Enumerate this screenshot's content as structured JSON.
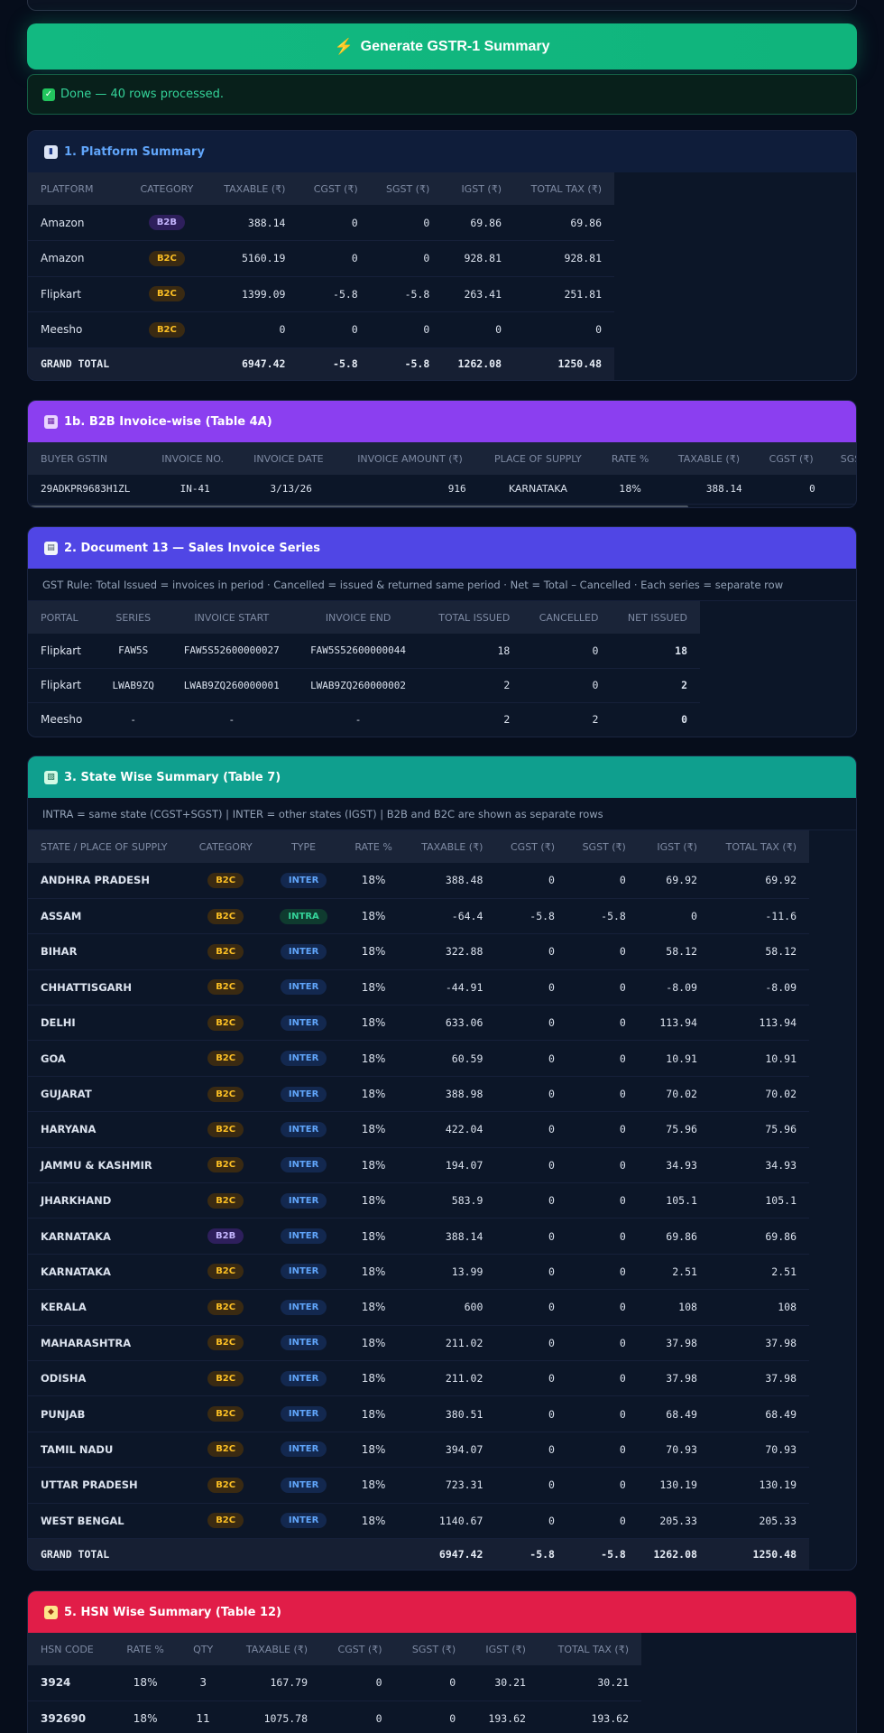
{
  "generate_button": {
    "label": "Generate GSTR-1 Summary"
  },
  "status": {
    "message": "Done — 40 rows processed."
  },
  "platform_summary": {
    "title": "1. Platform Summary",
    "columns": [
      "PLATFORM",
      "CATEGORY",
      "TAXABLE (₹)",
      "CGST (₹)",
      "SGST (₹)",
      "IGST (₹)",
      "TOTAL TAX (₹)"
    ],
    "rows": [
      {
        "platform": "Amazon",
        "category": "B2B",
        "taxable": "388.14",
        "cgst": "0",
        "sgst": "0",
        "igst": "69.86",
        "total": "69.86"
      },
      {
        "platform": "Amazon",
        "category": "B2C",
        "taxable": "5160.19",
        "cgst": "0",
        "sgst": "0",
        "igst": "928.81",
        "total": "928.81"
      },
      {
        "platform": "Flipkart",
        "category": "B2C",
        "taxable": "1399.09",
        "cgst": "-5.8",
        "sgst": "-5.8",
        "igst": "263.41",
        "total": "251.81"
      },
      {
        "platform": "Meesho",
        "category": "B2C",
        "taxable": "0",
        "cgst": "0",
        "sgst": "0",
        "igst": "0",
        "total": "0"
      }
    ],
    "total": {
      "label": "GRAND TOTAL",
      "taxable": "6947.42",
      "cgst": "-5.8",
      "sgst": "-5.8",
      "igst": "1262.08",
      "total": "1250.48"
    }
  },
  "b2b_invoice": {
    "title": "1b. B2B Invoice-wise (Table 4A)",
    "columns": [
      "BUYER GSTIN",
      "INVOICE NO.",
      "INVOICE DATE",
      "INVOICE AMOUNT (₹)",
      "PLACE OF SUPPLY",
      "RATE %",
      "TAXABLE (₹)",
      "CGST (₹)",
      "SGS"
    ],
    "rows": [
      {
        "gstin": "29ADKPR9683H1ZL",
        "invoice_no": "IN-41",
        "date": "3/13/26",
        "amount": "916",
        "place": "KARNATAKA",
        "rate": "18%",
        "taxable": "388.14",
        "cgst": "0",
        "sgst": ""
      }
    ]
  },
  "document_series": {
    "title": "2. Document 13 — Sales Invoice Series",
    "note": "GST Rule: Total Issued = invoices in period · Cancelled = issued & returned same period · Net = Total – Cancelled · Each series = separate row",
    "columns": [
      "PORTAL",
      "SERIES",
      "INVOICE START",
      "INVOICE END",
      "TOTAL ISSUED",
      "CANCELLED",
      "NET ISSUED"
    ],
    "rows": [
      {
        "portal": "Flipkart",
        "series": "FAW5S",
        "start": "FAW5S52600000027",
        "end": "FAW5S52600000044",
        "issued": "18",
        "cancelled": "0",
        "net": "18"
      },
      {
        "portal": "Flipkart",
        "series": "LWAB9ZQ",
        "start": "LWAB9ZQ260000001",
        "end": "LWAB9ZQ260000002",
        "issued": "2",
        "cancelled": "0",
        "net": "2"
      },
      {
        "portal": "Meesho",
        "series": "-",
        "start": "-",
        "end": "-",
        "issued": "2",
        "cancelled": "2",
        "net": "0"
      }
    ]
  },
  "state_summary": {
    "title": "3. State Wise Summary (Table 7)",
    "note": "INTRA = same state (CGST+SGST) | INTER = other states (IGST) | B2B and B2C are shown as separate rows",
    "columns": [
      "STATE / PLACE OF SUPPLY",
      "CATEGORY",
      "TYPE",
      "RATE %",
      "TAXABLE (₹)",
      "CGST (₹)",
      "SGST (₹)",
      "IGST (₹)",
      "TOTAL TAX (₹)"
    ],
    "rows": [
      {
        "state": "ANDHRA PRADESH",
        "category": "B2C",
        "type": "INTER",
        "rate": "18%",
        "taxable": "388.48",
        "cgst": "0",
        "sgst": "0",
        "igst": "69.92",
        "total": "69.92"
      },
      {
        "state": "ASSAM",
        "category": "B2C",
        "type": "INTRA",
        "rate": "18%",
        "taxable": "-64.4",
        "cgst": "-5.8",
        "sgst": "-5.8",
        "igst": "0",
        "total": "-11.6"
      },
      {
        "state": "BIHAR",
        "category": "B2C",
        "type": "INTER",
        "rate": "18%",
        "taxable": "322.88",
        "cgst": "0",
        "sgst": "0",
        "igst": "58.12",
        "total": "58.12"
      },
      {
        "state": "CHHATTISGARH",
        "category": "B2C",
        "type": "INTER",
        "rate": "18%",
        "taxable": "-44.91",
        "cgst": "0",
        "sgst": "0",
        "igst": "-8.09",
        "total": "-8.09"
      },
      {
        "state": "DELHI",
        "category": "B2C",
        "type": "INTER",
        "rate": "18%",
        "taxable": "633.06",
        "cgst": "0",
        "sgst": "0",
        "igst": "113.94",
        "total": "113.94"
      },
      {
        "state": "GOA",
        "category": "B2C",
        "type": "INTER",
        "rate": "18%",
        "taxable": "60.59",
        "cgst": "0",
        "sgst": "0",
        "igst": "10.91",
        "total": "10.91"
      },
      {
        "state": "GUJARAT",
        "category": "B2C",
        "type": "INTER",
        "rate": "18%",
        "taxable": "388.98",
        "cgst": "0",
        "sgst": "0",
        "igst": "70.02",
        "total": "70.02"
      },
      {
        "state": "HARYANA",
        "category": "B2C",
        "type": "INTER",
        "rate": "18%",
        "taxable": "422.04",
        "cgst": "0",
        "sgst": "0",
        "igst": "75.96",
        "total": "75.96"
      },
      {
        "state": "JAMMU & KASHMIR",
        "category": "B2C",
        "type": "INTER",
        "rate": "18%",
        "taxable": "194.07",
        "cgst": "0",
        "sgst": "0",
        "igst": "34.93",
        "total": "34.93"
      },
      {
        "state": "JHARKHAND",
        "category": "B2C",
        "type": "INTER",
        "rate": "18%",
        "taxable": "583.9",
        "cgst": "0",
        "sgst": "0",
        "igst": "105.1",
        "total": "105.1"
      },
      {
        "state": "KARNATAKA",
        "category": "B2B",
        "type": "INTER",
        "rate": "18%",
        "taxable": "388.14",
        "cgst": "0",
        "sgst": "0",
        "igst": "69.86",
        "total": "69.86"
      },
      {
        "state": "KARNATAKA",
        "category": "B2C",
        "type": "INTER",
        "rate": "18%",
        "taxable": "13.99",
        "cgst": "0",
        "sgst": "0",
        "igst": "2.51",
        "total": "2.51"
      },
      {
        "state": "KERALA",
        "category": "B2C",
        "type": "INTER",
        "rate": "18%",
        "taxable": "600",
        "cgst": "0",
        "sgst": "0",
        "igst": "108",
        "total": "108"
      },
      {
        "state": "MAHARASHTRA",
        "category": "B2C",
        "type": "INTER",
        "rate": "18%",
        "taxable": "211.02",
        "cgst": "0",
        "sgst": "0",
        "igst": "37.98",
        "total": "37.98"
      },
      {
        "state": "ODISHA",
        "category": "B2C",
        "type": "INTER",
        "rate": "18%",
        "taxable": "211.02",
        "cgst": "0",
        "sgst": "0",
        "igst": "37.98",
        "total": "37.98"
      },
      {
        "state": "PUNJAB",
        "category": "B2C",
        "type": "INTER",
        "rate": "18%",
        "taxable": "380.51",
        "cgst": "0",
        "sgst": "0",
        "igst": "68.49",
        "total": "68.49"
      },
      {
        "state": "TAMIL NADU",
        "category": "B2C",
        "type": "INTER",
        "rate": "18%",
        "taxable": "394.07",
        "cgst": "0",
        "sgst": "0",
        "igst": "70.93",
        "total": "70.93"
      },
      {
        "state": "UTTAR PRADESH",
        "category": "B2C",
        "type": "INTER",
        "rate": "18%",
        "taxable": "723.31",
        "cgst": "0",
        "sgst": "0",
        "igst": "130.19",
        "total": "130.19"
      },
      {
        "state": "WEST BENGAL",
        "category": "B2C",
        "type": "INTER",
        "rate": "18%",
        "taxable": "1140.67",
        "cgst": "0",
        "sgst": "0",
        "igst": "205.33",
        "total": "205.33"
      }
    ],
    "total": {
      "label": "GRAND TOTAL",
      "taxable": "6947.42",
      "cgst": "-5.8",
      "sgst": "-5.8",
      "igst": "1262.08",
      "total": "1250.48"
    }
  },
  "hsn_summary": {
    "title": "5. HSN Wise Summary (Table 12)",
    "columns": [
      "HSN CODE",
      "RATE %",
      "QTY",
      "TAXABLE (₹)",
      "CGST (₹)",
      "SGST (₹)",
      "IGST (₹)",
      "TOTAL TAX (₹)"
    ],
    "rows": [
      {
        "hsn": "3924",
        "rate": "18%",
        "qty": "3",
        "taxable": "167.79",
        "cgst": "0",
        "sgst": "0",
        "igst": "30.21",
        "total": "30.21"
      },
      {
        "hsn": "392690",
        "rate": "18%",
        "qty": "11",
        "taxable": "1075.78",
        "cgst": "0",
        "sgst": "0",
        "igst": "193.62",
        "total": "193.62"
      }
    ]
  },
  "icons": {
    "generate": "lightning-bolt-icon",
    "done": "check-icon",
    "platform": "bar-chart-icon",
    "b2b": "building-icon",
    "document": "document-icon",
    "state": "map-icon",
    "hsn": "tag-icon"
  },
  "colors": {
    "generate": "#12b981",
    "platform_header": "#0f1d3a",
    "b2b_header": "#8b3ff0",
    "document_header": "#5046e5",
    "state_header": "#0f9f8e",
    "hsn_header": "#e11d48",
    "b2b_badge": "#c4b5fd",
    "b2c_badge": "#fbbf24",
    "inter_badge": "#60a5fa",
    "intra_badge": "#34d399"
  }
}
